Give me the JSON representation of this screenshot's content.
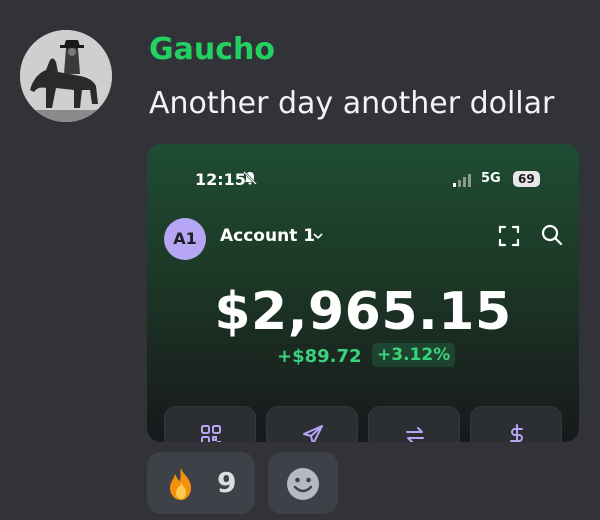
{
  "message": {
    "username": "Gaucho",
    "username_color": "#23d160",
    "text": "Another day another dollar"
  },
  "embed": {
    "status_bar": {
      "time": "12:15",
      "network": "5G",
      "battery": "69"
    },
    "account": {
      "initials": "A1",
      "name": "Account 1"
    },
    "balance": "$2,965.15",
    "change_amount": "+$89.72",
    "change_percent": "+3.12%",
    "accent_color": "#3ad37d",
    "actions": [
      {
        "icon": "qr-code-icon"
      },
      {
        "icon": "send-icon"
      },
      {
        "icon": "swap-icon"
      },
      {
        "icon": "dollar-icon"
      }
    ]
  },
  "reactions": [
    {
      "emoji": "fire-icon",
      "count": "9"
    }
  ],
  "add_reaction_icon": "smiley-icon"
}
